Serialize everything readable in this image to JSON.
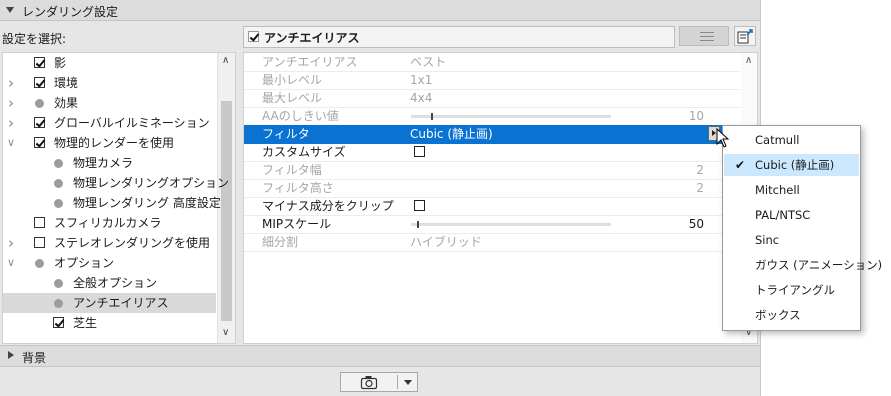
{
  "header": {
    "title": "レンダリング設定"
  },
  "tree": {
    "label": "設定を選択:",
    "items": [
      {
        "label": "影",
        "indent": 0,
        "arrow": "",
        "kind": "checkbox",
        "checked": true
      },
      {
        "label": "環境",
        "indent": 0,
        "arrow": ">",
        "kind": "checkbox",
        "checked": true
      },
      {
        "label": "効果",
        "indent": 0,
        "arrow": ">",
        "kind": "dot"
      },
      {
        "label": "グローバルイルミネーション",
        "indent": 0,
        "arrow": ">",
        "kind": "checkbox",
        "checked": true
      },
      {
        "label": "物理的レンダーを使用",
        "indent": 0,
        "arrow": "v",
        "kind": "checkbox",
        "checked": true
      },
      {
        "label": "物理カメラ",
        "indent": 1,
        "arrow": "",
        "kind": "dot"
      },
      {
        "label": "物理レンダリングオプション",
        "indent": 1,
        "arrow": "",
        "kind": "dot"
      },
      {
        "label": "物理レンダリング 高度設定",
        "indent": 1,
        "arrow": "",
        "kind": "dot"
      },
      {
        "label": "スフィリカルカメラ",
        "indent": 0,
        "arrow": "",
        "kind": "checkbox",
        "checked": false
      },
      {
        "label": "ステレオレンダリングを使用",
        "indent": 0,
        "arrow": ">",
        "kind": "checkbox",
        "checked": false
      },
      {
        "label": "オプション",
        "indent": 0,
        "arrow": "v",
        "kind": "dot"
      },
      {
        "label": "全般オプション",
        "indent": 1,
        "arrow": "",
        "kind": "dot"
      },
      {
        "label": "アンチエイリアス",
        "indent": 1,
        "arrow": "",
        "kind": "dot",
        "selected": true
      },
      {
        "label": "芝生",
        "indent": 1,
        "arrow": "",
        "kind": "checkbox",
        "checked": true
      }
    ]
  },
  "properties": {
    "title": "アンチエイリアス",
    "rows": [
      {
        "name": "アンチエイリアス",
        "value": "ベスト",
        "dim": true
      },
      {
        "name": "最小レベル",
        "value": "1x1",
        "dim": true
      },
      {
        "name": "最大レベル",
        "value": "4x4",
        "dim": true
      },
      {
        "name": "AAのしきい値",
        "value": "",
        "number": "10",
        "slider": 0.1,
        "dim": true
      },
      {
        "name": "フィルタ",
        "value": "Cubic (静止画)",
        "selected": true,
        "dropdown": true
      },
      {
        "name": "カスタムサイズ",
        "value": "",
        "checkbox": true
      },
      {
        "name": "フィルタ幅",
        "value": "",
        "number": "2",
        "dim": true
      },
      {
        "name": "フィルタ高さ",
        "value": "",
        "number": "2",
        "dim": true
      },
      {
        "name": "マイナス成分をクリップ",
        "value": "",
        "checkbox": true
      },
      {
        "name": "MIPスケール",
        "value": "",
        "number": "50",
        "slider": 0.03
      },
      {
        "name": "細分割",
        "value": "ハイブリッド",
        "dim": true
      }
    ]
  },
  "background_section": {
    "title": "背景"
  },
  "filter_menu": {
    "options": [
      "Catmull",
      "Cubic (静止画)",
      "Mitchell",
      "PAL/NTSC",
      "Sinc",
      "ガウス (アニメーション)",
      "トライアングル",
      "ボックス"
    ],
    "selected": "Cubic (静止画)"
  },
  "colors": {
    "selection": "#0a72d1",
    "menu_highlight": "#cce8ff"
  }
}
